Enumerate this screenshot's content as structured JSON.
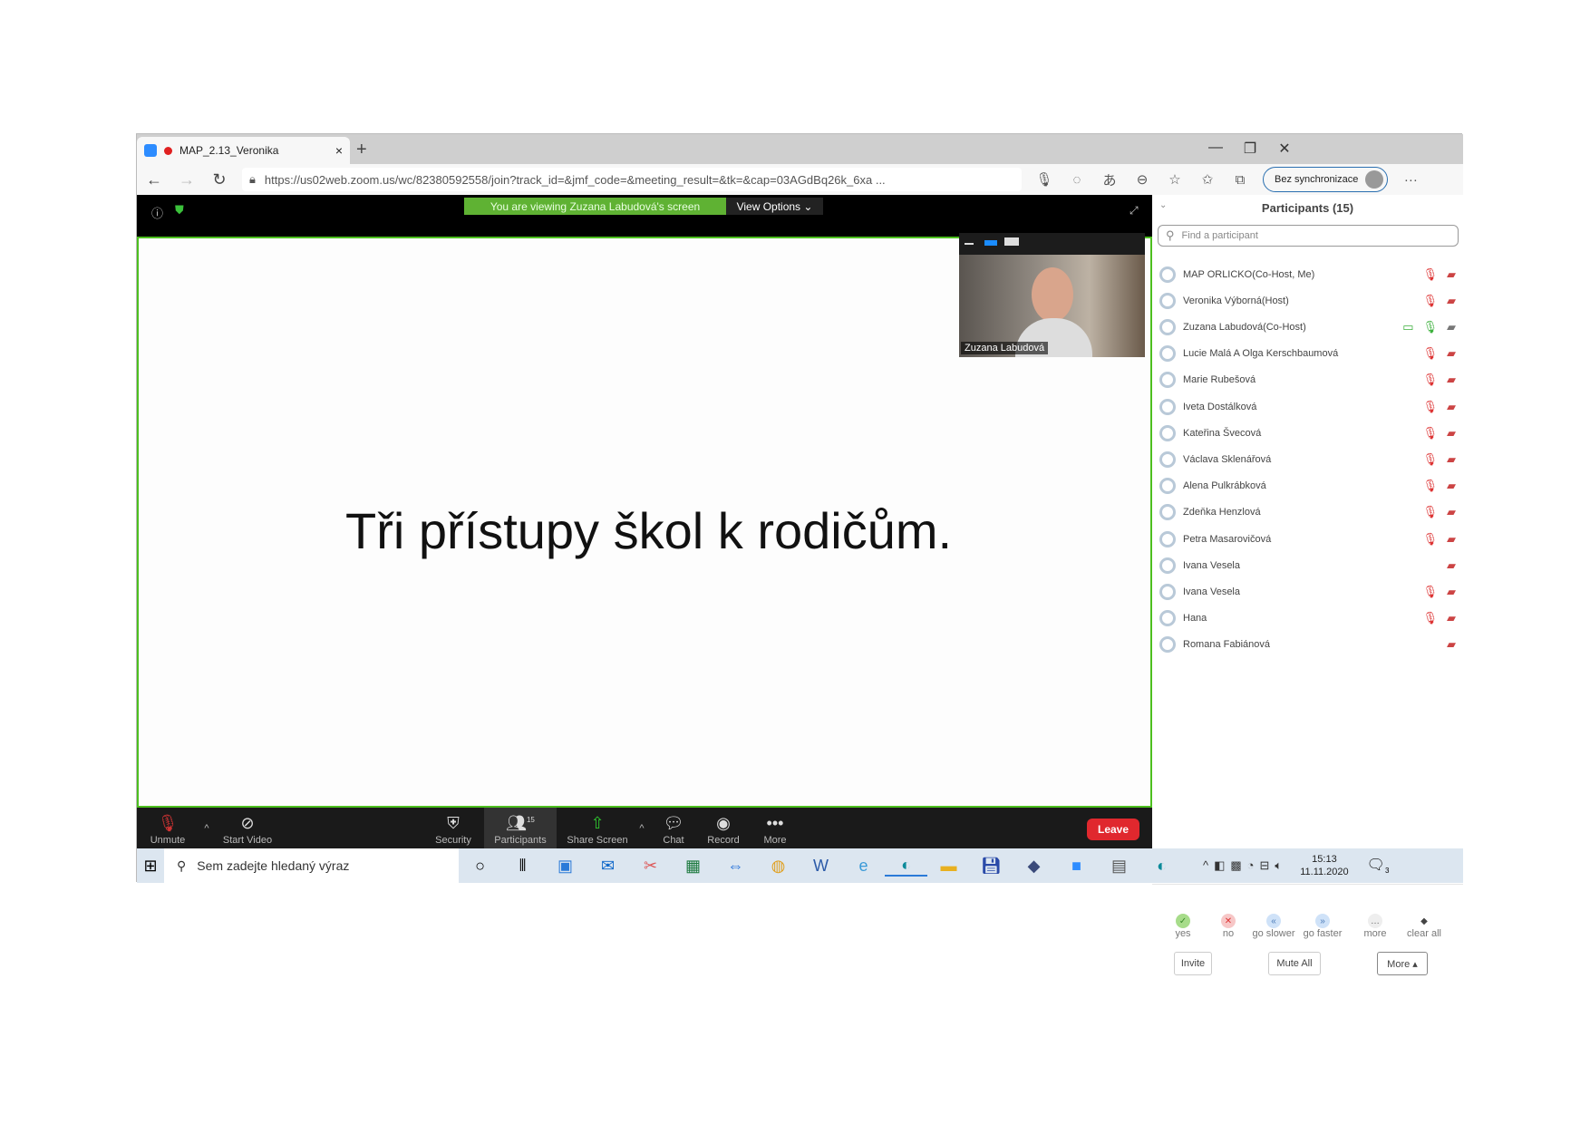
{
  "browser": {
    "tab_title": "MAP_2.13_Veronika",
    "url": "https://us02web.zoom.us/wc/82380592558/join?track_id=&jmf_code=&meeting_result=&tk=&cap=03AGdBq26k_6xa ...",
    "profile_label": "Bez synchronizace"
  },
  "meeting": {
    "banner": "You are viewing Zuzana Labudová's screen",
    "view_options": "View Options",
    "slide_text": "Tři přístupy škol k rodičům.",
    "video_name": "Zuzana Labudová",
    "participants_count": "15"
  },
  "toolbar": {
    "unmute": "Unmute",
    "start_video": "Start Video",
    "security": "Security",
    "participants": "Participants",
    "share_screen": "Share Screen",
    "chat": "Chat",
    "record": "Record",
    "more": "More",
    "leave": "Leave"
  },
  "panel": {
    "title": "Participants (15)",
    "search_placeholder": "Find a participant",
    "participants": [
      {
        "name": "MAP ORLICKO(Co-Host, Me)",
        "mic": "muted",
        "video": "off"
      },
      {
        "name": "Veronika Výborná(Host)",
        "mic": "muted",
        "video": "off"
      },
      {
        "name": "Zuzana Labudová(Co-Host)",
        "mic": "on",
        "video": "on",
        "sharing": true
      },
      {
        "name": "Lucie Malá A Olga Kerschbaumová",
        "mic": "muted",
        "video": "off"
      },
      {
        "name": "Marie Rubešová",
        "mic": "muted",
        "video": "off"
      },
      {
        "name": "Iveta Dostálková",
        "mic": "muted",
        "video": "off"
      },
      {
        "name": "Kateřina Švecová",
        "mic": "muted",
        "video": "off"
      },
      {
        "name": "Václava Sklenářová",
        "mic": "muted",
        "video": "off"
      },
      {
        "name": "Alena Pulkrábková",
        "mic": "muted",
        "video": "off"
      },
      {
        "name": "Zdeňka Henzlová",
        "mic": "muted",
        "video": "off"
      },
      {
        "name": "Petra Masarovičová",
        "mic": "muted",
        "video": "off"
      },
      {
        "name": "Ivana Vesela",
        "mic": "none",
        "video": "off"
      },
      {
        "name": "Ivana Vesela",
        "mic": "muted",
        "video": "off"
      },
      {
        "name": "Hana",
        "mic": "muted",
        "video": "off"
      },
      {
        "name": "Romana Fabiánová",
        "mic": "none",
        "video": "off"
      }
    ],
    "reactions": [
      "yes",
      "no",
      "go slower",
      "go faster",
      "more",
      "clear all"
    ],
    "invite": "Invite",
    "mute_all": "Mute All",
    "more": "More ▴"
  },
  "taskbar": {
    "search_placeholder": "Sem zadejte hledaný výraz",
    "time": "15:13",
    "date": "11.11.2020",
    "notifications": "3"
  },
  "colors": {
    "zoom_green": "#5fb233",
    "leave_red": "#e0282e",
    "zoom_blue": "#2d8cff"
  }
}
